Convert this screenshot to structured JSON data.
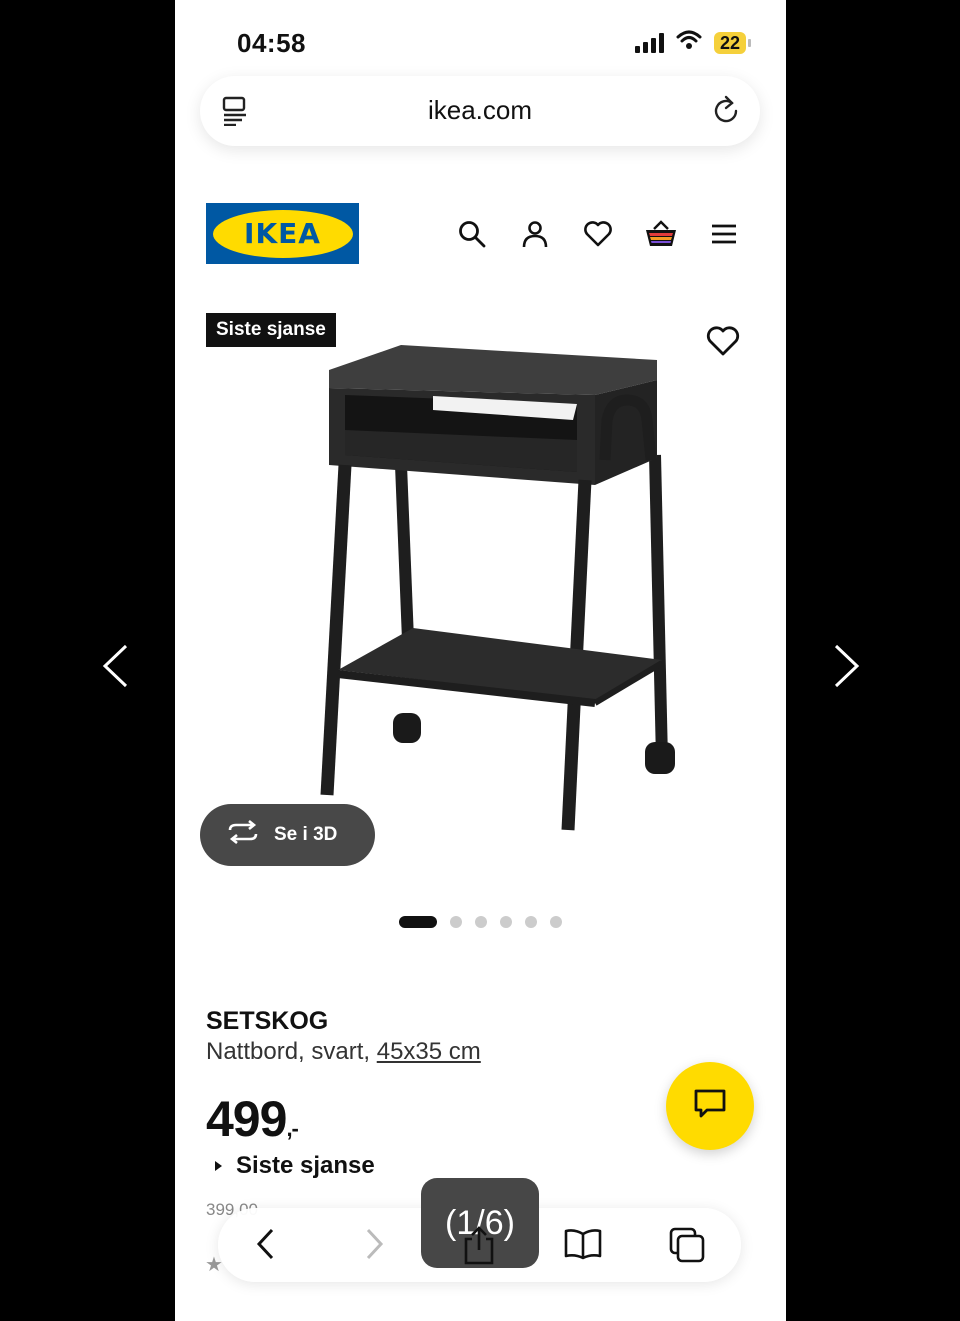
{
  "status": {
    "time": "04:58",
    "battery": "22"
  },
  "browser": {
    "url": "ikea.com",
    "page_counter": "(1/6)"
  },
  "header": {
    "logo_text": "IKEA"
  },
  "gallery": {
    "badge": "Siste sjanse",
    "view_3d_label": "Se i 3D",
    "total_images": 6,
    "active_image": 1
  },
  "product": {
    "name": "SETSKOG",
    "description": "Nattbord, svart, ",
    "size_link": "45x35 cm",
    "price": "499",
    "price_suffix": ",-",
    "offer_label": "Siste sjanse",
    "previous_price_partial": "399,00"
  },
  "colors": {
    "ikea_blue": "#0058a3",
    "ikea_yellow": "#ffdb00",
    "badge_bg": "#111111"
  }
}
